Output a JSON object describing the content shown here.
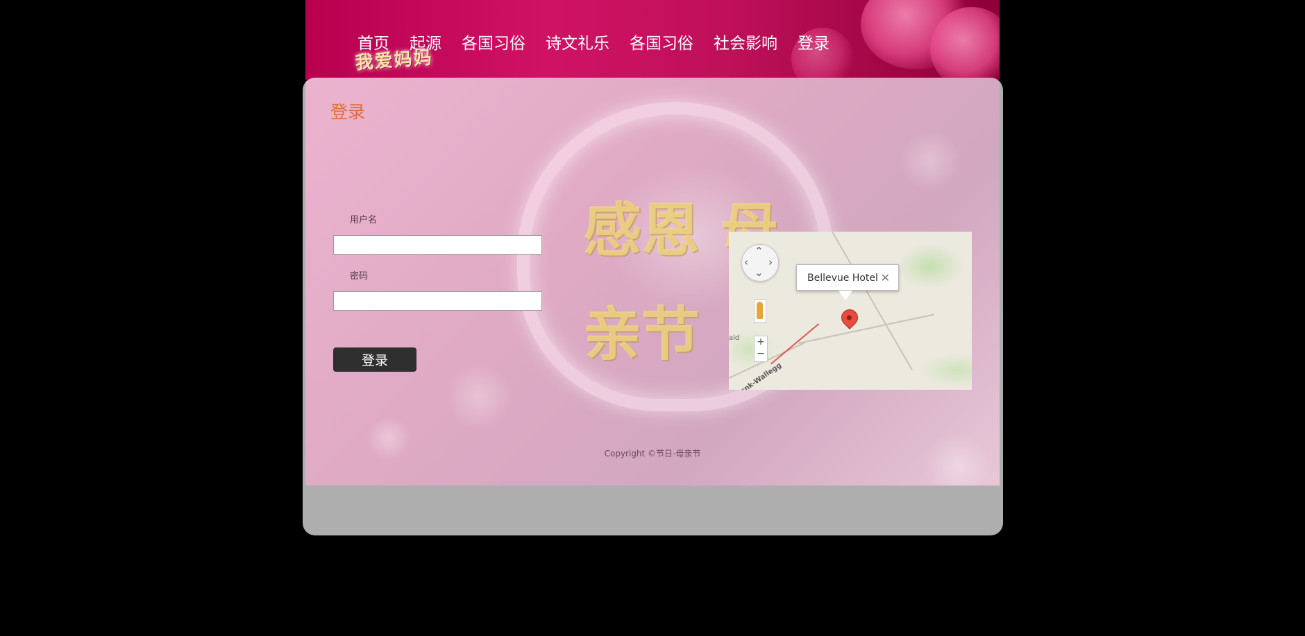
{
  "header": {
    "logo_text": "我爱妈妈",
    "nav": [
      "首页",
      "起源",
      "各国习俗",
      "诗文礼乐",
      "各国习俗",
      "社会影响",
      "登录"
    ]
  },
  "main": {
    "title": "登录",
    "decor_text": "感恩 母亲节",
    "form": {
      "username_label": "用户名",
      "username_value": "",
      "password_label": "密码",
      "password_value": "",
      "submit_label": "登录"
    },
    "map": {
      "infowindow_title": "Bellevue Hotel",
      "close_glyph": "✕",
      "zoom_in": "+",
      "zoom_out": "−",
      "place_label_left": "ald",
      "place_label_road": "Fcnk-Wallegg"
    },
    "footer": "Copyright ©节日-母亲节"
  },
  "colors": {
    "header_bg": "#c0105a",
    "title": "#e06a3a",
    "button_bg": "#2f2f2f",
    "footer_bg": "#aeaeae"
  }
}
